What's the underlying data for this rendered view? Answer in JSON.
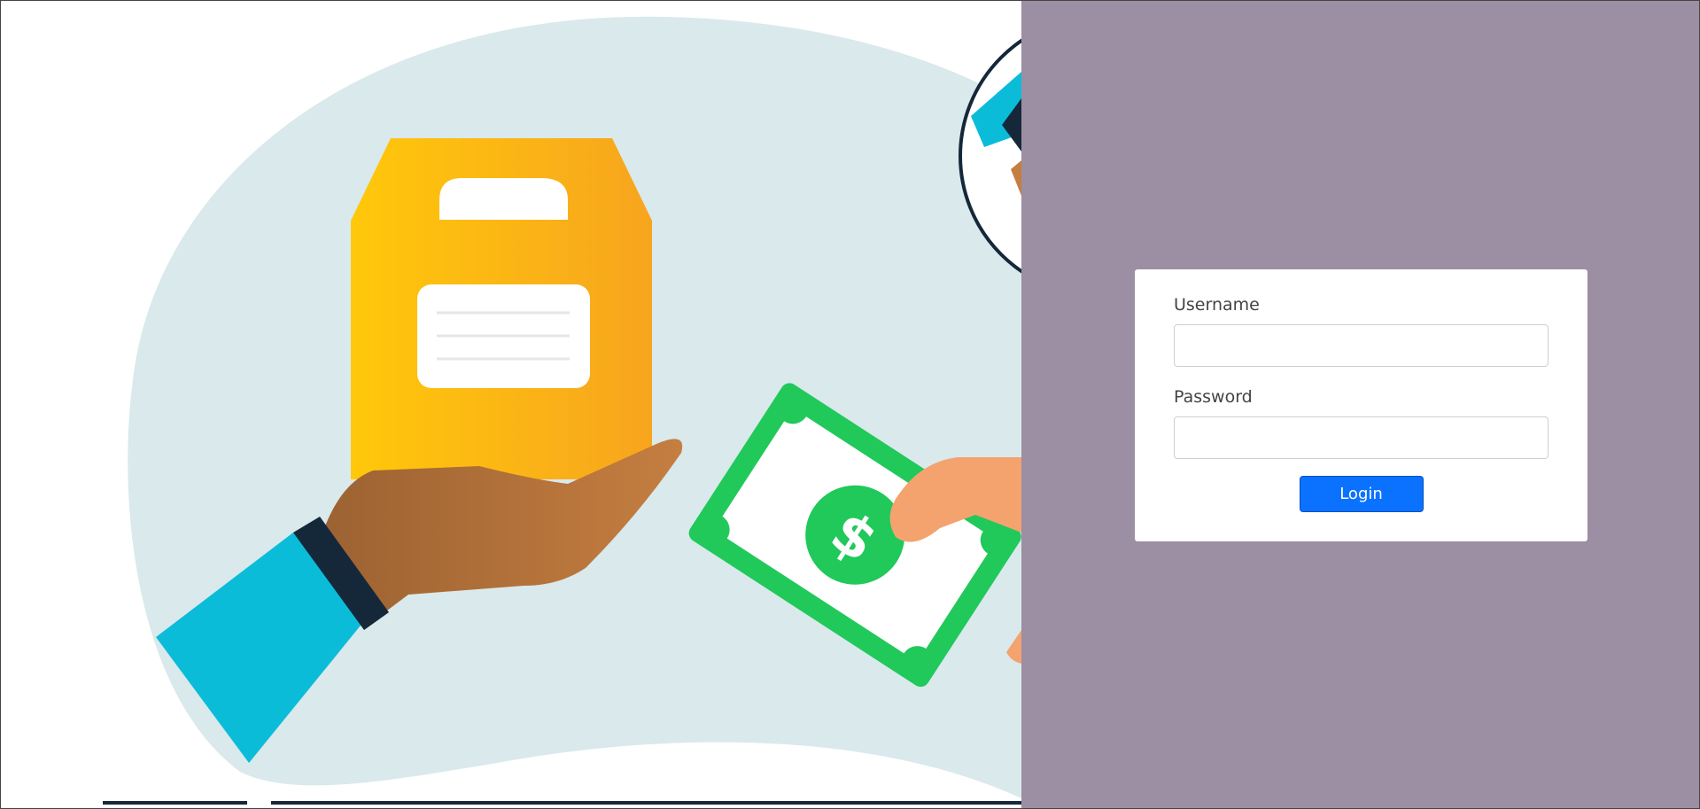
{
  "login_form": {
    "username_label": "Username",
    "username_value": "",
    "password_label": "Password",
    "password_value": "",
    "login_button_label": "Login"
  },
  "hero_image": {
    "icon": "hand-exchange-box-for-money-illustration",
    "money_symbol": "$"
  },
  "colors": {
    "side_panel": "#9c8ea3",
    "card": "#ffffff",
    "button": "#0a72ff",
    "button_text": "#ffffff",
    "label_text": "#444444",
    "blob": "#d9e9ec",
    "box": "#f9b314",
    "bill": "#20c95a",
    "sleeve": "#0bbcd9"
  }
}
